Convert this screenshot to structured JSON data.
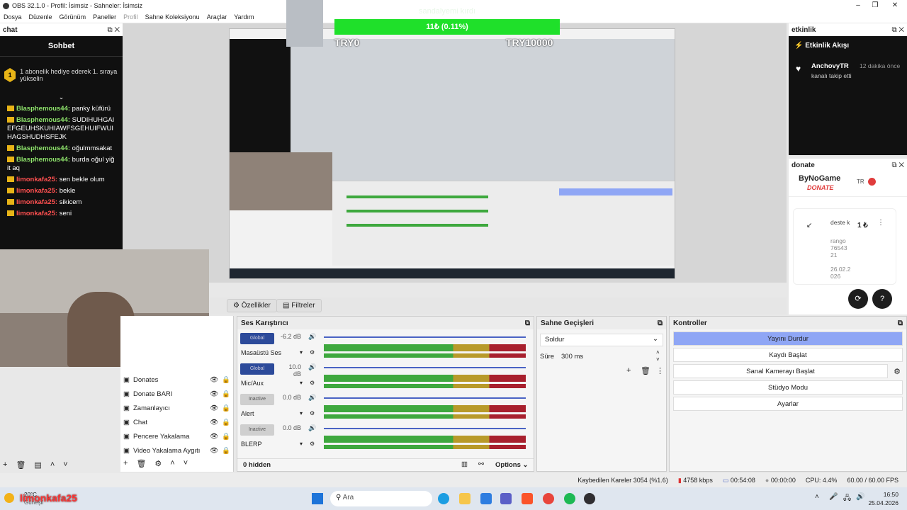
{
  "window": {
    "title": "OBS 32.1.0 - Profil: İsimsiz - Sahneler: İsimsiz"
  },
  "menu": [
    "Dosya",
    "Düzenle",
    "Görünüm",
    "Paneller",
    "Profil",
    "Sahne Koleksiyonu",
    "Araçlar",
    "Yardım"
  ],
  "chat": {
    "dock_title": "chat",
    "header": "Sohbet",
    "pinned_rank": "1",
    "pinned_text": "1 abonelik hediye ederek 1. sıraya yükselin",
    "messages": [
      {
        "user": "Blasphemous44:",
        "text": "panky küfürü",
        "color": "green"
      },
      {
        "user": "Blasphemous44:",
        "text": "SUDIHUHGAIEFGEUHSKUHIAWFSGEHUIFWUIHAGSHUDHSFEJK",
        "color": "green"
      },
      {
        "user": "Blasphemous44:",
        "text": "oğulmmsakat",
        "color": "green"
      },
      {
        "user": "Blasphemous44:",
        "text": "burda oğul yiğit aq",
        "color": "green"
      },
      {
        "user": "limonkafa25:",
        "text": "sen bekle olum",
        "color": "red"
      },
      {
        "user": "limonkafa25:",
        "text": "bekle",
        "color": "red"
      },
      {
        "user": "limonkafa25:",
        "text": "sikicem",
        "color": "red"
      },
      {
        "user": "limonkafa25:",
        "text": "seni",
        "color": "red"
      }
    ]
  },
  "overlay": {
    "goal_title": "sandalyemi kırdı",
    "goal_progress": "11₺ (0.11%)",
    "goal_percent": 0.11,
    "goal_min": "TRY0",
    "goal_max": "TRY10000"
  },
  "etkinlik": {
    "dock_title": "etkinlik",
    "header": "Etkinlik Akışı",
    "event_user": "AnchovyTR",
    "event_time": "12 dakika önce",
    "event_text": "kanalı takip etti"
  },
  "donate": {
    "dock_title": "donate",
    "brand": "ByNoGame",
    "brand_sub": "DONATE",
    "lang": "TR",
    "amount": "1 ₺",
    "label": "deste k",
    "user": "rango 76543 21",
    "date": "26.02.2 026"
  },
  "toolbar": {
    "properties": "Özellikler",
    "filters": "Filtreler"
  },
  "sources": [
    {
      "name": "Donates"
    },
    {
      "name": "Donate BARI"
    },
    {
      "name": "Zamanlayıcı"
    },
    {
      "name": "Chat"
    },
    {
      "name": "Pencere Yakalama"
    },
    {
      "name": "Video Yakalama Aygıtı"
    }
  ],
  "mixer": {
    "title": "Ses Karıştırıcı",
    "hidden": "0 hidden",
    "options": "Options",
    "channels": [
      {
        "name": "Masaüstü Ses",
        "db": "-6.2 dB",
        "state": "Global"
      },
      {
        "name": "Mic/Aux",
        "db": "10.0 dB",
        "state": "Global"
      },
      {
        "name": "Alert",
        "db": "0.0 dB",
        "state": "Inactive"
      },
      {
        "name": "BLERP",
        "db": "0.0 dB",
        "state": "Inactive"
      }
    ],
    "scale": [
      "-60",
      "-54",
      "-48",
      "-42",
      "-36",
      "-30",
      "-24",
      "-18",
      "-12",
      "-6",
      "0"
    ]
  },
  "transitions": {
    "title": "Sahne Geçişleri",
    "selected": "Soldur",
    "duration_label": "Süre",
    "duration": "300 ms"
  },
  "controls": {
    "title": "Kontroller",
    "buttons": [
      "Yayını Durdur",
      "Kaydı Başlat",
      "Sanal Kamerayı Başlat",
      "Stüdyo Modu",
      "Ayarlar"
    ]
  },
  "status": {
    "dropped": "Kaybedilen Kareler 3054 (%1.6)",
    "kbps": "4758 kbps",
    "live_time": "00:54:08",
    "rec_time": "00:00:00",
    "cpu": "CPU: 4.4%",
    "fps": "60.00 / 60.00 FPS"
  },
  "taskbar": {
    "weather_temp": "20°C",
    "weather_text": "Güneşli",
    "search": "Ara",
    "clock_time": "16:50",
    "clock_date": "25.04.2026",
    "overlay_name": "limonkafa25"
  }
}
